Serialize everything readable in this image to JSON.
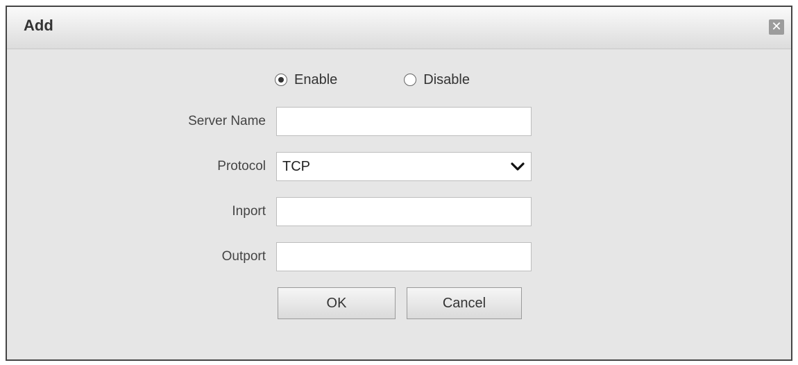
{
  "dialog": {
    "title": "Add",
    "close_icon": "close-icon"
  },
  "status": {
    "options": [
      {
        "label": "Enable",
        "selected": true
      },
      {
        "label": "Disable",
        "selected": false
      }
    ]
  },
  "fields": {
    "server_name": {
      "label": "Server Name",
      "value": ""
    },
    "protocol": {
      "label": "Protocol",
      "value": "TCP",
      "icon": "chevron-down-icon"
    },
    "inport": {
      "label": "Inport",
      "value": ""
    },
    "outport": {
      "label": "Outport",
      "value": ""
    }
  },
  "buttons": {
    "ok": "OK",
    "cancel": "Cancel"
  }
}
